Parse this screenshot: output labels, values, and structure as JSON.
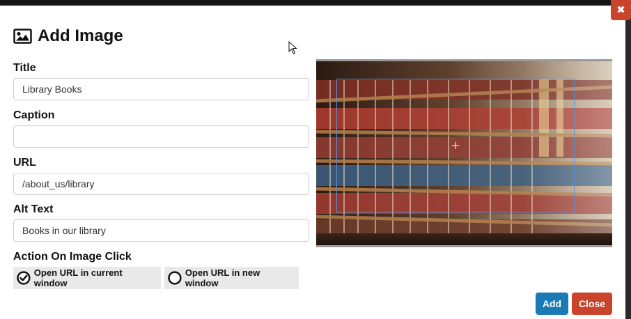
{
  "dialog": {
    "title": "Add Image",
    "close_icon": "close-icon"
  },
  "fields": {
    "title": {
      "label": "Title",
      "value": "Library Books",
      "placeholder": ""
    },
    "caption": {
      "label": "Caption",
      "value": "",
      "placeholder": ""
    },
    "url": {
      "label": "URL",
      "value": "/about_us/library",
      "placeholder": ""
    },
    "alt_text": {
      "label": "Alt Text",
      "value": "Books in our library",
      "placeholder": ""
    }
  },
  "action_on_click": {
    "label": "Action On Image Click",
    "options": [
      {
        "label": "Open URL in current window",
        "selected": true
      },
      {
        "label": "Open URL in new window",
        "selected": false
      }
    ]
  },
  "buttons": {
    "add": "Add",
    "close": "Close"
  },
  "colors": {
    "primary": "#1a7ab5",
    "danger": "#c9442a",
    "crop_border": "#5b8fd9"
  }
}
